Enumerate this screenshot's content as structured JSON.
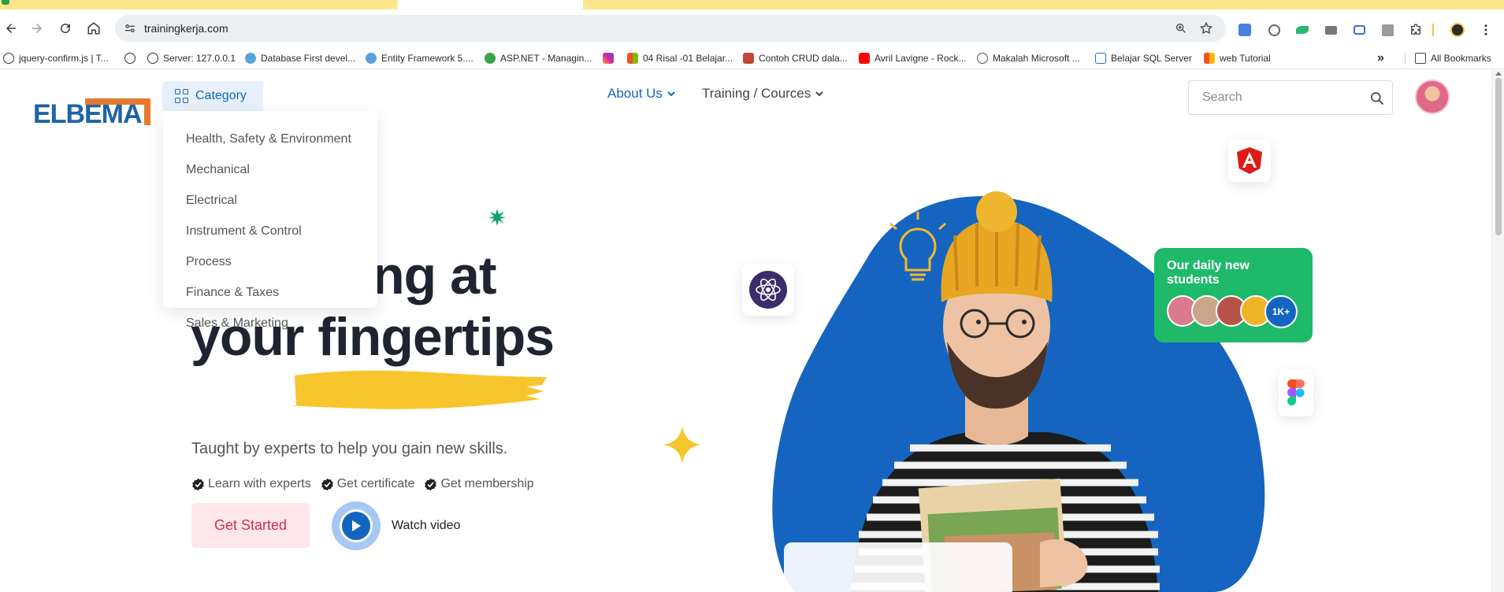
{
  "browser": {
    "url": "trainingkerja.com",
    "bookmarks": [
      {
        "label": "jquery-confirm.js | T..."
      },
      {
        "label": ""
      },
      {
        "label": "Server: 127.0.0.1"
      },
      {
        "label": "Database First devel..."
      },
      {
        "label": "Entity Framework 5...."
      },
      {
        "label": "ASP.NET - Managin..."
      },
      {
        "label": ""
      },
      {
        "label": "04 Risal -01 Belajar..."
      },
      {
        "label": "Contoh CRUD dala..."
      },
      {
        "label": "Avril Lavigne - Rock..."
      },
      {
        "label": "Makalah Microsoft ..."
      },
      {
        "label": "Belajar SQL Server"
      },
      {
        "label": "web Tutorial"
      }
    ],
    "overflow_label": "»",
    "all_bookmarks_label": "All Bookmarks"
  },
  "header": {
    "logo_text": "ELBEMA",
    "category_label": "Category",
    "nav": {
      "about": "About Us",
      "training": "Training / Cources"
    },
    "search_placeholder": "Search"
  },
  "category_menu": {
    "items": [
      "Health, Safety & Environment",
      "Mechanical",
      "Electrical",
      "Instrument & Control",
      "Process",
      "Finance & Taxes",
      "Sales & Marketing"
    ]
  },
  "hero": {
    "title_line1_visible": "s learning at",
    "title_line2_prefix": "your",
    "title_line2_highlight": "fingertips",
    "subtitle": "Taught by experts to help you gain new skills.",
    "perks": [
      "Learn with experts",
      "Get certificate",
      "Get membership"
    ],
    "cta_primary": "Get Started",
    "cta_video": "Watch video"
  },
  "students_card": {
    "title": "Our daily new students",
    "count": "1K+"
  },
  "colors": {
    "brand_blue": "#1565c0",
    "accent_yellow": "#f7c52c",
    "green_card": "#1fb96a",
    "cta_red": "#d32f4a"
  }
}
